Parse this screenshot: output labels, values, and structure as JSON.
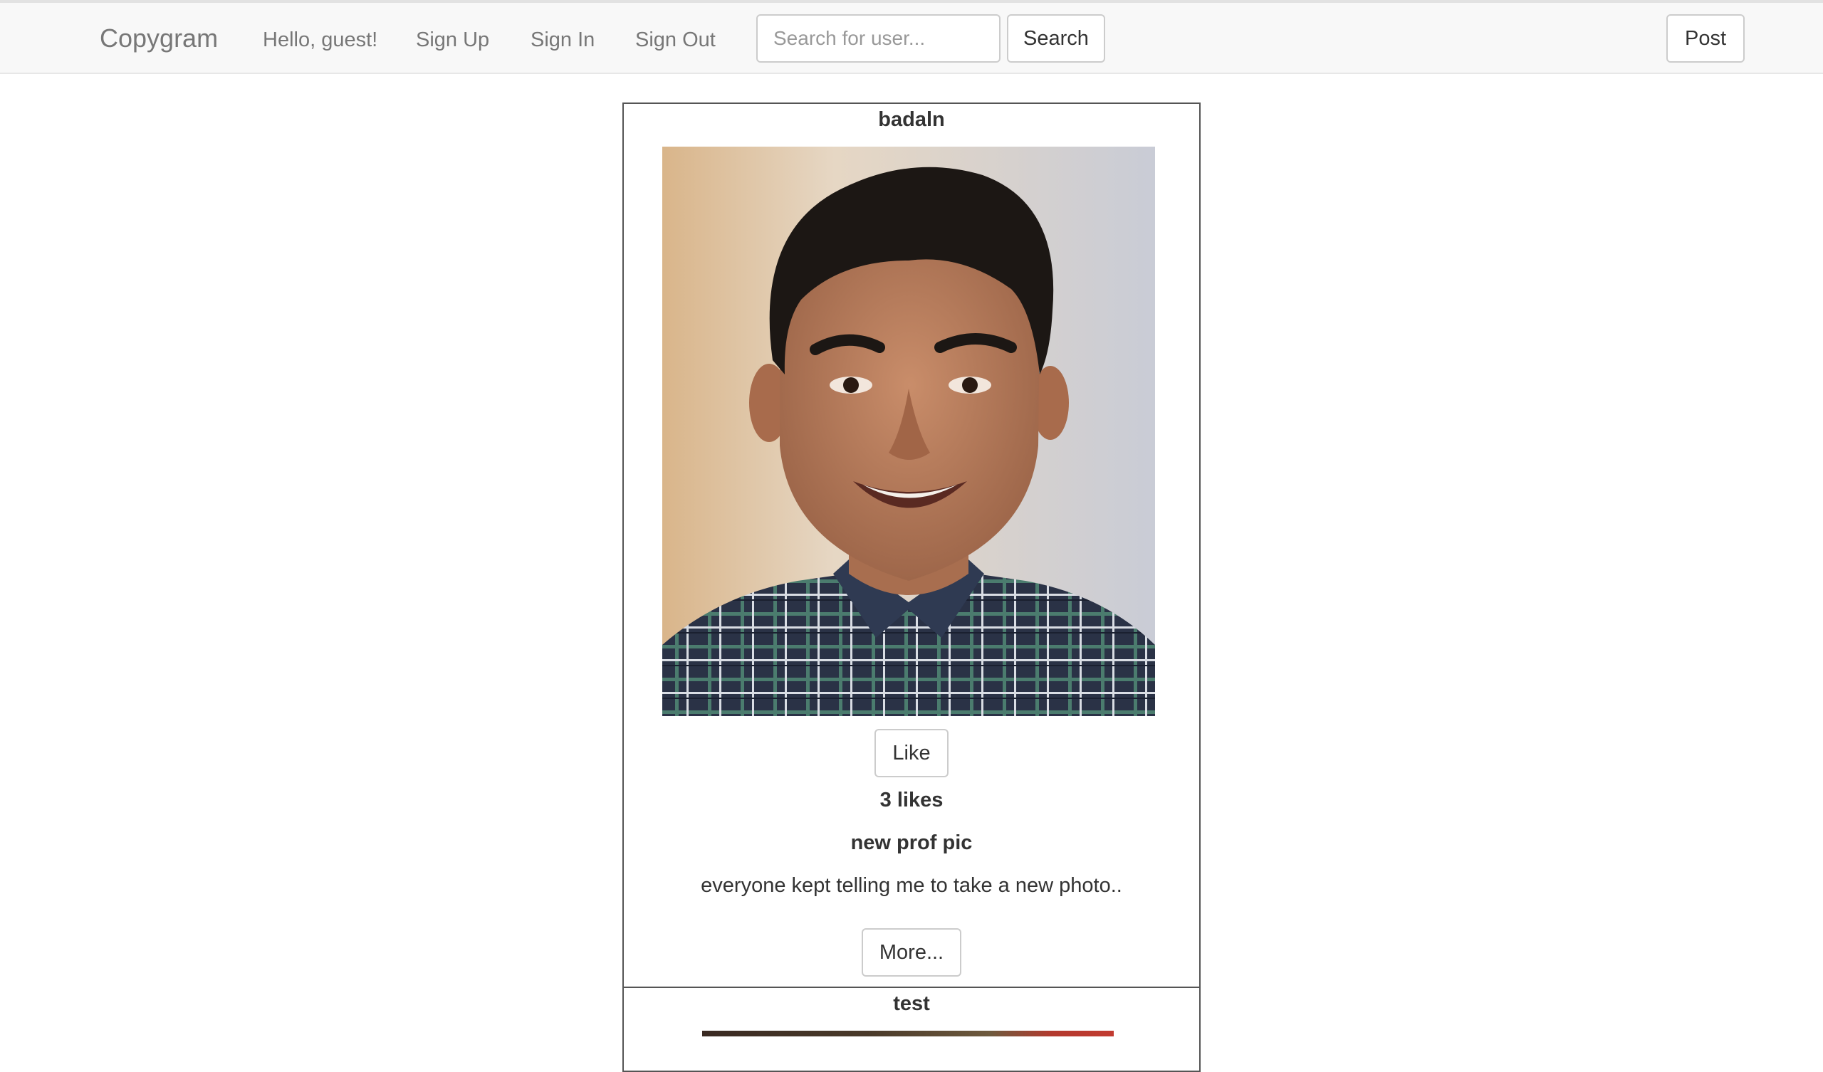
{
  "navbar": {
    "brand": "Copygram",
    "greeting": "Hello, guest!",
    "links": [
      "Sign Up",
      "Sign In",
      "Sign Out"
    ],
    "search_placeholder": "Search for user...",
    "search_button": "Search",
    "post_button": "Post"
  },
  "posts": [
    {
      "username": "badaln",
      "like_button": "Like",
      "likes": "3 likes",
      "title": "new prof pic",
      "body": "everyone kept telling me to take a new photo..",
      "more_button": "More..."
    },
    {
      "username": "test"
    }
  ],
  "colors": {
    "navbar_bg": "#f8f8f8",
    "nav_text": "#777777",
    "card_border": "#555555"
  }
}
